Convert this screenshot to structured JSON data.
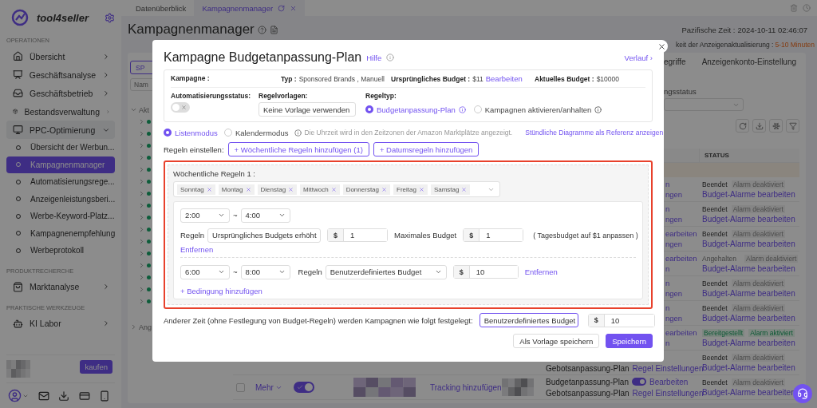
{
  "tabbar": {
    "tabs": [
      {
        "label": "Datenüberblick",
        "selected": false
      },
      {
        "label": "Kampagnenmanager",
        "selected": true
      }
    ]
  },
  "header": {
    "title": "Kampagnenmanager",
    "time_label": "Pazifische Zeit :",
    "time": "2024-10-11 02:46:07",
    "update_label": "keit der Anzeigenaktualisierung :",
    "update_value": "5-10 Minuten"
  },
  "sidebar": {
    "brand": "tool4seller",
    "sections": [
      {
        "title": "OPERATIONEN",
        "items": [
          {
            "label": "Übersicht",
            "expanded": false
          },
          {
            "label": "Geschäftsanalyse",
            "expanded": false
          },
          {
            "label": "Geschäftsbetrieb",
            "expanded": false
          },
          {
            "label": "Bestandsverwaltung",
            "expanded": false
          },
          {
            "label": "PPC-Optimierung",
            "expanded": true,
            "children": [
              {
                "label": "Übersicht der Werbun...",
                "selected": false
              },
              {
                "label": "Kampagnenmanager",
                "selected": true
              },
              {
                "label": "Automatisierungsrege...",
                "selected": false
              },
              {
                "label": "Anzeigenleistungsberi...",
                "selected": false
              },
              {
                "label": "Werbe-Keyword-Platz...",
                "selected": false
              },
              {
                "label": "Kampagnenempfehlung",
                "selected": false
              },
              {
                "label": "Werbeprotokoll",
                "selected": false
              }
            ]
          }
        ]
      },
      {
        "title": "PRODUKTRECHERCHE",
        "items": [
          {
            "label": "Marktanalyse",
            "expanded": false
          }
        ]
      },
      {
        "title": "PRAKTISCHE WERKZEUGE",
        "items": [
          {
            "label": "KI Labor",
            "expanded": false
          }
        ]
      }
    ],
    "buy": "kaufen"
  },
  "left_panel": {
    "button": "SP",
    "search_placeholder": "Nam",
    "tree": [
      {
        "label": "Akt",
        "expanded": true,
        "children": [
          {
            "expanded": false
          },
          {
            "expanded": false
          },
          {
            "expanded": false
          },
          {
            "expanded": false
          },
          {
            "expanded": false
          },
          {
            "expanded": false
          },
          {
            "expanded": false
          },
          {
            "expanded": false
          },
          {
            "expanded": false
          },
          {
            "expanded": false
          },
          {
            "expanded": false
          },
          {
            "expanded": false
          },
          {
            "expanded": false
          },
          {
            "expanded": false
          },
          {
            "expanded": false
          },
          {
            "expanded": false
          }
        ]
      },
      {
        "label": "Ang",
        "expanded": false
      }
    ]
  },
  "right_panel": {
    "tabs": [
      "egriffe",
      "Anzeigenkonto-Einstellung"
    ],
    "filter_label": "ngsstatus"
  },
  "table": {
    "status_header": "STATUS",
    "rows": [
      {
        "rules": [
          {
            "kind": "cut",
            "text": "n"
          },
          {
            "kind": "cut",
            "text": "ngen"
          }
        ],
        "status": {
          "kind": "ended",
          "state": "Beendet",
          "alarm": "Alarm deaktiviert",
          "alarm_on": false
        },
        "link": "Budget-Alarme bearbeiten"
      },
      {
        "rules": [
          {
            "kind": "cut",
            "text": "n"
          },
          {
            "kind": "cut",
            "text": "ngen"
          }
        ],
        "status": {
          "kind": "ended",
          "state": "Beendet",
          "alarm": "Alarm deaktiviert",
          "alarm_on": false
        },
        "link": "Budget-Alarme bearbeiten"
      },
      {
        "rules": [
          {
            "kind": "cut",
            "text": "earbeiten"
          },
          {
            "kind": "cut",
            "text": "ngen"
          }
        ],
        "status": {
          "kind": "ended",
          "state": "Beendet",
          "alarm": "Alarm deaktiviert",
          "alarm_on": false
        },
        "link": "Budget-Alarme bearbeiten"
      },
      {
        "rules": [
          {
            "kind": "cut",
            "text": "earbeiten"
          },
          {
            "kind": "cut",
            "text": "n"
          }
        ],
        "status": {
          "kind": "paused",
          "state": "Angehalten",
          "alarm": "Alarm deaktiviert",
          "alarm_on": false
        },
        "link": "Budget-Alarme bearbeiten"
      },
      {
        "rules": [
          {
            "kind": "cut",
            "text": "n"
          },
          {
            "kind": "cut",
            "text": "ngen"
          }
        ],
        "status": {
          "kind": "ended",
          "state": "Beendet",
          "alarm": "Alarm deaktiviert",
          "alarm_on": false
        },
        "link": "Budget-Alarme bearbeiten"
      },
      {
        "rules": [
          {
            "kind": "cut",
            "text": "n"
          },
          {
            "kind": "cut",
            "text": "ngen"
          }
        ],
        "status": {
          "kind": "ended",
          "state": "Beendet",
          "alarm": "Alarm deaktiviert",
          "alarm_on": false
        },
        "link": "Budget-Alarme bearbeiten"
      },
      {
        "rules": [
          {
            "kind": "cut",
            "text": "earbeiten"
          },
          {
            "kind": "cut",
            "text": "n"
          }
        ],
        "status": {
          "kind": "ready",
          "state": "Bereitgestellt",
          "alarm": "Alarm aktiviert",
          "alarm_on": true
        },
        "link": "Budget-Alarme bearbeiten"
      },
      {
        "rules": [
          {
            "kind": "hidden"
          },
          {
            "kind": "plan",
            "plan": "Gebotsanpassung-Plan",
            "link": "Regel Einstellungen"
          }
        ],
        "status": {
          "kind": "ended",
          "state": "Beendet",
          "alarm": "Alarm deaktiviert",
          "alarm_on": false
        },
        "link": "Budget-Alarme bearbeiten"
      },
      {
        "cells": {
          "checked": false,
          "more": "Mehr",
          "active": true,
          "tracking": "Tracking hinzufügen"
        },
        "rules": [
          {
            "kind": "plan",
            "plan": "Budgetanpassung-Plan",
            "on": true,
            "link": "Bearbeiten"
          },
          {
            "kind": "plan",
            "plan": "Gebotsanpassung-Plan",
            "link": "Regel Einstellungen"
          }
        ],
        "status": {
          "kind": "ended",
          "state": "Beendet",
          "alarm": "Alarm deaktiviert",
          "alarm_on": false
        },
        "link": "Budget-Alarme bearbeiten"
      }
    ]
  },
  "modal": {
    "title": "Kampagne Budgetanpassung-Plan",
    "help": "Hilfe",
    "history": "Verlauf ›",
    "info": {
      "campaign_label": "Kampagne :",
      "type_label": "Typ :",
      "type": "Sponsored Brands , Manuell",
      "original_label": "Ursprüngliches Budget :",
      "original": "$11",
      "edit": "Bearbeiten",
      "current_label": "Aktuelles Budget :",
      "current": "$10000"
    },
    "automation": {
      "label": "Automatisierungsstatus:",
      "on": false
    },
    "template": {
      "label": "Regelvorlagen:",
      "value": "Keine Vorlage verwenden"
    },
    "rule_type": {
      "label": "Regeltyp:",
      "options": [
        {
          "label": "Budgetanpassung-Plan",
          "selected": true
        },
        {
          "label": "Kampagnen aktivieren/anhalten",
          "selected": false
        }
      ]
    },
    "modes": [
      {
        "label": "Listenmodus",
        "selected": true
      },
      {
        "label": "Kalendermodus",
        "selected": false
      }
    ],
    "note": "Die Uhrzeit wird in den Zeitzonen der Amazon Marktplätze angezeigt.",
    "chart_link": "Stündliche Diagramme als Referenz anzeigen",
    "rules_label": "Regeln einstellen:",
    "add_buttons": [
      "+ Wöchentliche Regeln hinzufügen (1)",
      "+ Datumsregeln hinzufügen"
    ],
    "weekly": {
      "title": "Wöchentliche Regeln 1 :",
      "days": [
        "Sonntag",
        "Montag",
        "Dienstag",
        "Mittwoch",
        "Donnerstag",
        "Freitag",
        "Samstag"
      ],
      "conditions": [
        {
          "kind": "increase",
          "from": "2:00",
          "separator": "~",
          "to": "4:00",
          "rules_label": "Regeln",
          "rule": "Ursprüngliches Budgets erhöht",
          "currency": "$",
          "amount": "1",
          "max_label": "Maximales Budget",
          "max_currency": "$",
          "max_amount": "1",
          "hint": "( Tagesbudget auf $1 anpassen )",
          "remove": "Entfernen"
        },
        {
          "kind": "custom",
          "from": "6:00",
          "separator": "~",
          "to": "8:00",
          "rules_label": "Regeln",
          "rule": "Benutzerdefiniertes Budget",
          "currency": "$",
          "amount": "10",
          "remove": "Entfernen"
        }
      ],
      "add_condition": "+ Bedingung hinzufügen"
    },
    "other": {
      "label": "Anderer Zeit (ohne Festlegung von Budget-Regeln) werden Kampagnen wie folgt festgelegt:",
      "value": "Benutzerdefiniertes Budget",
      "expanded": true,
      "currency": "$",
      "amount": "10"
    },
    "buttons": [
      {
        "label": "Als Vorlage speichern",
        "kind": "secondary"
      },
      {
        "label": "Speichern",
        "kind": "primary"
      }
    ]
  }
}
